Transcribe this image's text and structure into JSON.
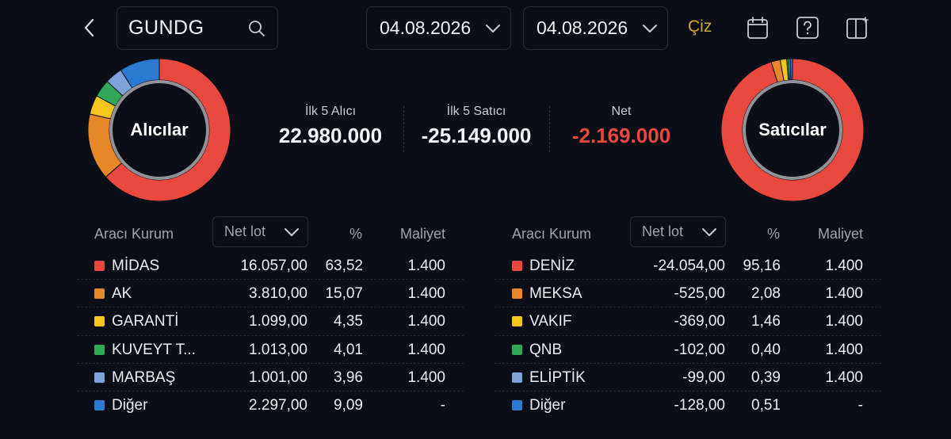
{
  "header": {
    "symbol": "GUNDG",
    "date_from": "04.08.2026",
    "date_to": "04.08.2026",
    "draw_label": "Çiz",
    "icons": [
      "back-chevron-icon",
      "search-icon",
      "chevron-down-icon",
      "calendar-icon",
      "help-icon",
      "layout-toggle-icon"
    ]
  },
  "buyers_donut": {
    "label": "Alıcılar"
  },
  "sellers_donut": {
    "label": "Satıcılar"
  },
  "summary": {
    "top5_buyers_label": "İlk 5 Alıcı",
    "top5_buyers_value": "22.980.000",
    "top5_sellers_label": "İlk 5 Satıcı",
    "top5_sellers_value": "-25.149.000",
    "net_label": "Net",
    "net_value": "-2.169.000",
    "net_color": "#e8483d"
  },
  "buyers_table": {
    "col_broker": "Aracı Kurum",
    "col_net": "Net lot",
    "col_pct": "%",
    "col_cost": "Maliyet",
    "rows": [
      {
        "name": "MİDAS",
        "lot": "16.057,00",
        "pct": "63,52",
        "cost": "1.400",
        "color": "#e8483d"
      },
      {
        "name": "AK",
        "lot": "3.810,00",
        "pct": "15,07",
        "cost": "1.400",
        "color": "#e8862a"
      },
      {
        "name": "GARANTİ",
        "lot": "1.099,00",
        "pct": "4,35",
        "cost": "1.400",
        "color": "#f4c51d"
      },
      {
        "name": "KUVEYT T...",
        "lot": "1.013,00",
        "pct": "4,01",
        "cost": "1.400",
        "color": "#2fa85a"
      },
      {
        "name": "MARBAŞ",
        "lot": "1.001,00",
        "pct": "3,96",
        "cost": "1.400",
        "color": "#7fa3d8"
      },
      {
        "name": "Diğer",
        "lot": "2.297,00",
        "pct": "9,09",
        "cost": "-",
        "color": "#2a7ad1"
      }
    ]
  },
  "sellers_table": {
    "col_broker": "Aracı Kurum",
    "col_net": "Net lot",
    "col_pct": "%",
    "col_cost": "Maliyet",
    "rows": [
      {
        "name": "DENİZ",
        "lot": "-24.054,00",
        "pct": "95,16",
        "cost": "1.400",
        "color": "#e8483d"
      },
      {
        "name": "MEKSA",
        "lot": "-525,00",
        "pct": "2,08",
        "cost": "1.400",
        "color": "#e8862a"
      },
      {
        "name": "VAKIF",
        "lot": "-369,00",
        "pct": "1,46",
        "cost": "1.400",
        "color": "#f4c51d"
      },
      {
        "name": "QNB",
        "lot": "-102,00",
        "pct": "0,40",
        "cost": "1.400",
        "color": "#2fa85a"
      },
      {
        "name": "ELİPTİK",
        "lot": "-99,00",
        "pct": "0,39",
        "cost": "1.400",
        "color": "#7fa3d8"
      },
      {
        "name": "Diğer",
        "lot": "-128,00",
        "pct": "0,51",
        "cost": "-",
        "color": "#2a7ad1"
      }
    ]
  },
  "accent_color": "#d4a93a"
}
